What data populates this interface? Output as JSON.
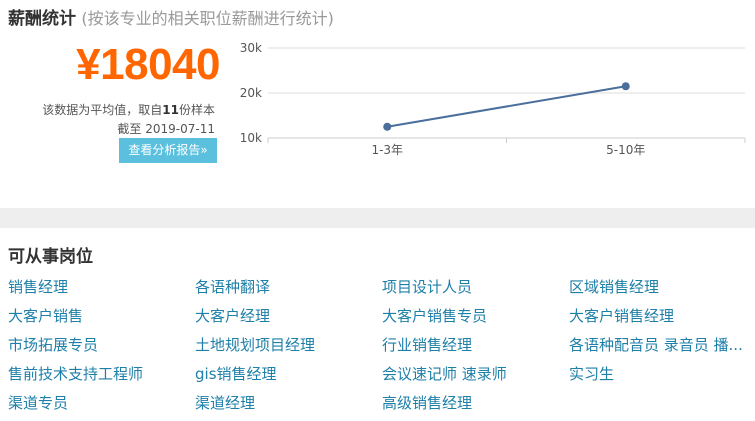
{
  "salary": {
    "title": "薪酬统计",
    "subtitle": "(按该专业的相关职位薪酬进行统计)",
    "amount": "¥18040",
    "note_prefix": "该数据为平均值，取自",
    "sample_count": "11",
    "note_suffix": "份样本",
    "date_label": "截至",
    "date": "2019-07-11",
    "report_button": "查看分析报告»"
  },
  "chart_data": {
    "type": "line",
    "categories": [
      "1-3年",
      "5-10年"
    ],
    "series": [
      {
        "values": [
          12500,
          21500
        ]
      }
    ],
    "ylim": [
      10000,
      30000
    ],
    "yticks": [
      {
        "value": 10000,
        "label": "10k"
      },
      {
        "value": 20000,
        "label": "20k"
      },
      {
        "value": 30000,
        "label": "30k"
      }
    ],
    "grid": true,
    "line_color": "#4a6f9c"
  },
  "jobs": {
    "title": "可从事岗位",
    "items": [
      "销售经理",
      "各语种翻译",
      "项目设计人员",
      "区域销售经理",
      "大客户销售",
      "大客户经理",
      "大客户销售专员",
      "大客户销售经理",
      "市场拓展专员",
      "土地规划项目经理",
      "行业销售经理",
      "各语种配音员 录音员 播...",
      "售前技术支持工程师",
      "gis销售经理",
      "会议速记师 速录师",
      "实习生",
      "渠道专员",
      "渠道经理",
      "高级销售经理"
    ]
  }
}
